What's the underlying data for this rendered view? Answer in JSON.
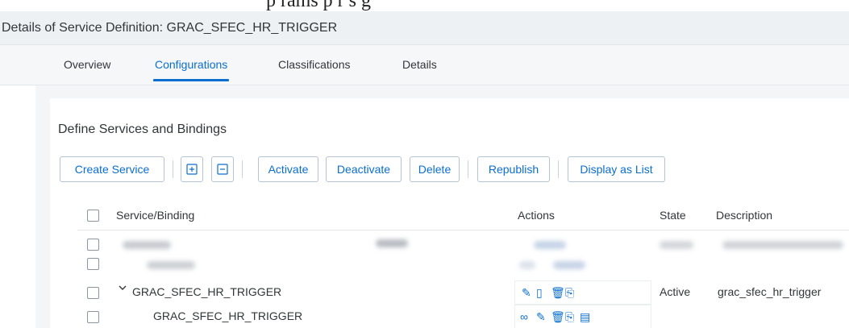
{
  "top_fragment": "p  rams     p          r                 s g",
  "page": {
    "title": "Details of Service Definition: GRAC_SFEC_HR_TRIGGER"
  },
  "tabs": [
    {
      "label": "Overview",
      "active": false
    },
    {
      "label": "Configurations",
      "active": true
    },
    {
      "label": "Classifications",
      "active": false
    },
    {
      "label": "Details",
      "active": false
    }
  ],
  "section": {
    "title": "Define Services and Bindings"
  },
  "toolbar": {
    "create_service": "Create Service",
    "expand_icon": "expand-all-icon",
    "collapse_icon": "collapse-all-icon",
    "activate": "Activate",
    "deactivate": "Deactivate",
    "delete": "Delete",
    "republish": "Republish",
    "display_as_list": "Display as List"
  },
  "table": {
    "columns": [
      "Service/Binding",
      "Actions",
      "State",
      "Description"
    ],
    "rows": [
      {
        "name": "",
        "state": "",
        "description": "",
        "blurred": true
      },
      {
        "name": "",
        "state": "",
        "description": "",
        "blurred": true
      },
      {
        "name": "GRAC_SFEC_HR_TRIGGER",
        "expandable": true,
        "state": "Active",
        "description": "grac_sfec_hr_trigger",
        "actions": [
          "edit-icon",
          "copy-icon",
          "delete-icon",
          "publish-icon"
        ]
      },
      {
        "name": "GRAC_SFEC_HR_TRIGGER",
        "expandable": false,
        "state": "",
        "description": "",
        "actions": [
          "preview-icon",
          "edit-icon",
          "delete-icon",
          "publish-icon",
          "test-icon"
        ]
      }
    ]
  },
  "colors": {
    "accent": "#0a6ed1",
    "text": "#32363a",
    "header_bg": "#eef1f4"
  }
}
